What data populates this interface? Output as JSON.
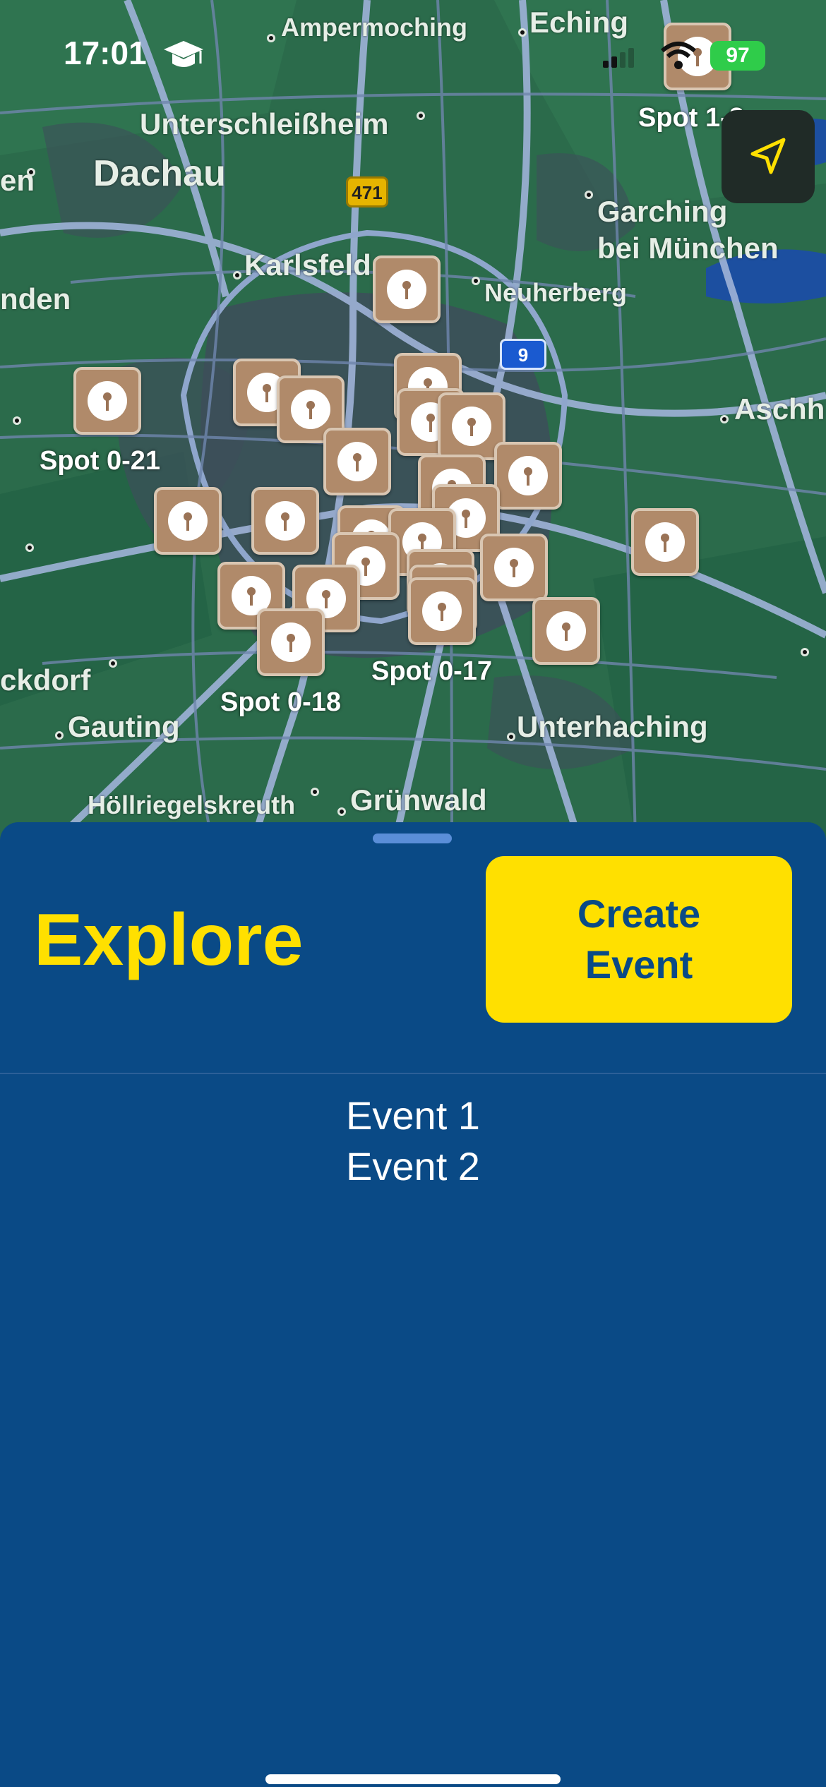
{
  "status_bar": {
    "time": "17:01",
    "battery": "97"
  },
  "map": {
    "places": [
      {
        "name": "Ampermoching",
        "cls": "small"
      },
      {
        "name": "Eching",
        "cls": "medium"
      },
      {
        "name": "Unterschleißheim",
        "cls": "medium"
      },
      {
        "name": "Dachau",
        "cls": "large"
      },
      {
        "name": "Garching",
        "cls": "medium"
      },
      {
        "name": "bei München",
        "cls": "medium"
      },
      {
        "name": "Karlsfeld",
        "cls": "medium"
      },
      {
        "name": "Neuherberg",
        "cls": "small"
      },
      {
        "name": "Aschh",
        "cls": "medium"
      },
      {
        "name": "nden",
        "cls": "medium"
      },
      {
        "name": "en",
        "cls": "medium"
      },
      {
        "name": "ckdorf",
        "cls": "medium"
      },
      {
        "name": "Gauting",
        "cls": "medium"
      },
      {
        "name": "Unterhaching",
        "cls": "medium"
      },
      {
        "name": "Höllriegelskreuth",
        "cls": "small"
      },
      {
        "name": "Grünwald",
        "cls": "medium"
      }
    ],
    "shields": [
      {
        "label": "471",
        "type": "yellow"
      },
      {
        "label": "9",
        "type": "blue"
      }
    ],
    "spot_labels": [
      "Spot 0-21",
      "Spot 0-18",
      "Spot 0-17",
      "Spot 1-2"
    ]
  },
  "sheet": {
    "title": "Explore",
    "create_button": "Create Event",
    "events": [
      "Event 1",
      "Event 2"
    ]
  },
  "icons": {
    "locate": "location-arrow-icon",
    "pin": "map-pin-icon",
    "status_extra": "graduation-cap-icon"
  }
}
